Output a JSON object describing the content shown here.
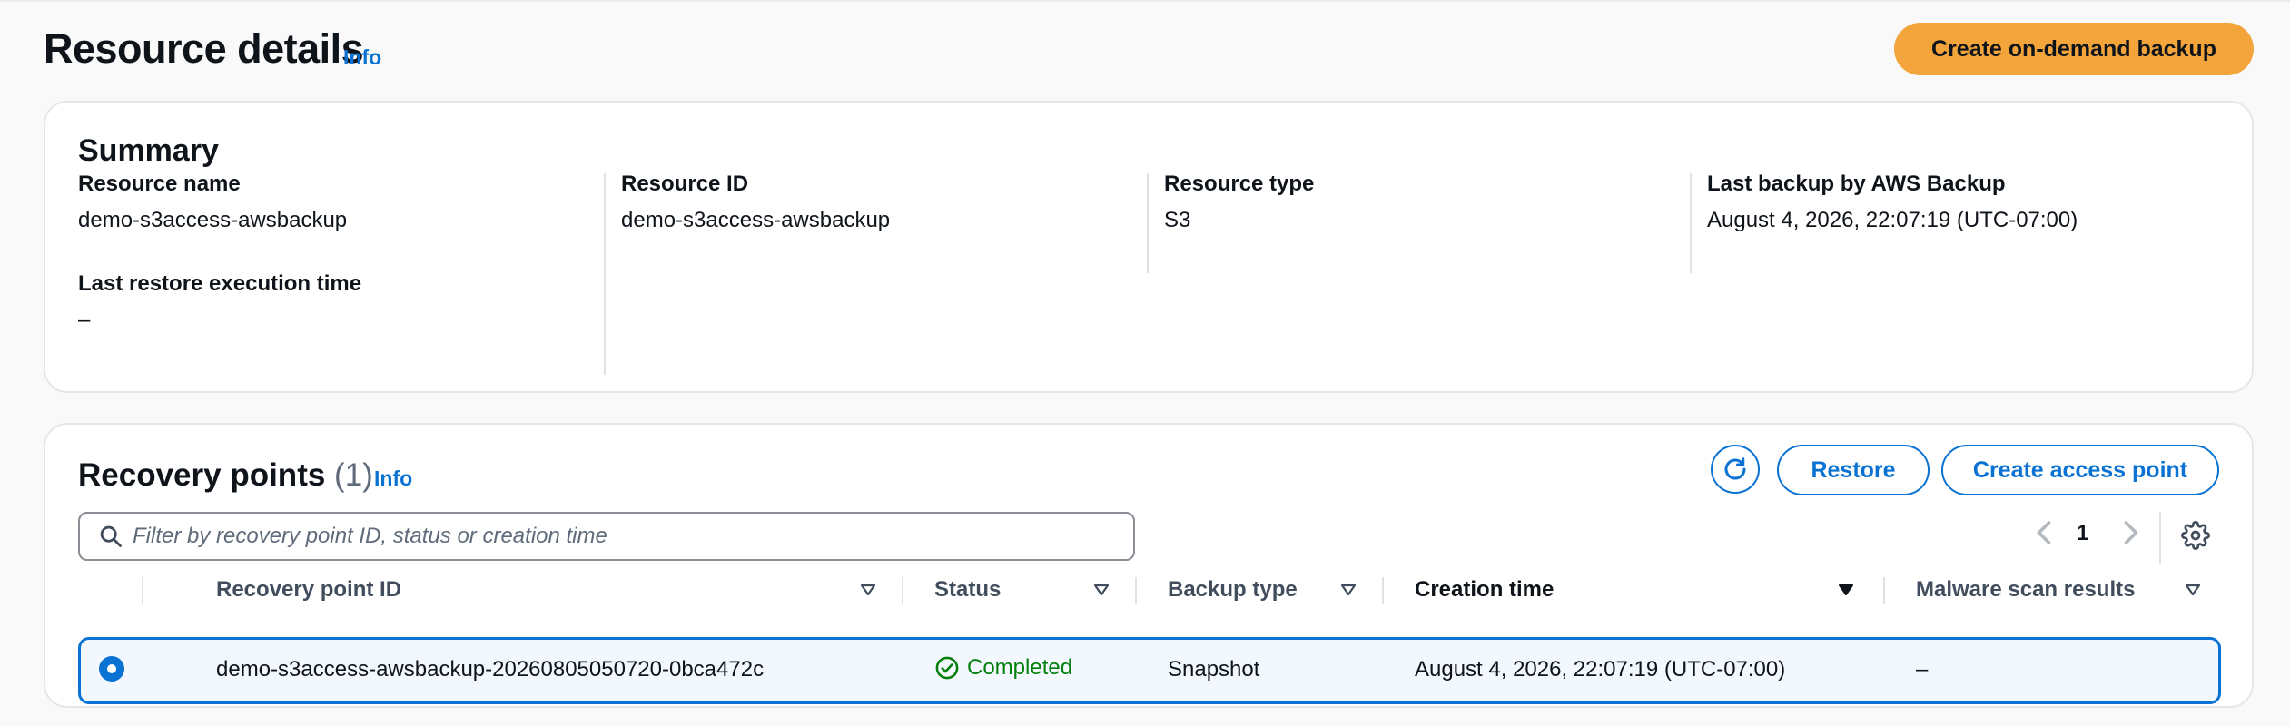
{
  "header": {
    "title": "Resource details",
    "info": "Info",
    "primary_button": "Create on-demand backup"
  },
  "summary": {
    "title": "Summary",
    "fields": [
      {
        "label": "Resource name",
        "value": "demo-s3access-awsbackup"
      },
      {
        "label": "Resource ID",
        "value": "demo-s3access-awsbackup"
      },
      {
        "label": "Resource type",
        "value": "S3"
      },
      {
        "label": "Last backup by AWS Backup",
        "value": "August 4, 2026, 22:07:19 (UTC-07:00)"
      },
      {
        "label": "Last restore execution time",
        "value": "–"
      }
    ]
  },
  "recovery": {
    "title": "Recovery points",
    "count": "(1)",
    "info": "Info",
    "restore_button": "Restore",
    "access_point_button": "Create access point",
    "search_placeholder": "Filter by recovery point ID, status or creation time",
    "page": "1",
    "columns": [
      "Recovery point ID",
      "Status",
      "Backup type",
      "Creation time",
      "Malware scan results"
    ],
    "rows": [
      {
        "id": "demo-s3access-awsbackup-20260805050720-0bca472c",
        "status": "Completed",
        "backup_type": "Snapshot",
        "creation_time": "August 4, 2026, 22:07:19 (UTC-07:00)",
        "malware": "–"
      }
    ]
  },
  "colors": {
    "accent": "#0972d3",
    "primary_button": "#f3a43a",
    "success": "#037f0c"
  }
}
